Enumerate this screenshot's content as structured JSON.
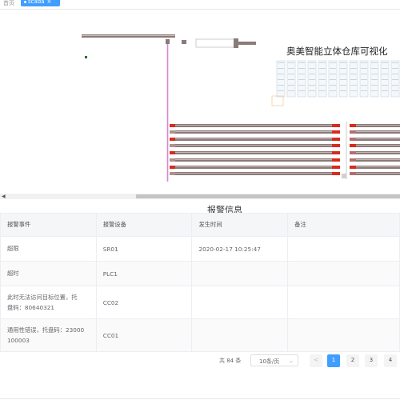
{
  "tabs": {
    "home": "首页",
    "active": "scada",
    "close": "×"
  },
  "canvas": {
    "title": "奥美智能立体仓库可视化"
  },
  "alarm": {
    "title": "报警信息",
    "columns": [
      "报警事件",
      "报警设备",
      "发生时间",
      "备注"
    ],
    "rows": [
      {
        "event": "超限",
        "device": "SR01",
        "time": "2020-02-17 10:25:47",
        "note": ""
      },
      {
        "event": "超时",
        "device": "PLC1",
        "time": "",
        "note": ""
      },
      {
        "event_line1": "此时无法访问目标位置，托",
        "event_line2": "盘码：80640321",
        "device": "CC02",
        "time": "",
        "note": ""
      },
      {
        "event_line1": "通用性错误，托盘码：23000",
        "event_line2": "100003",
        "device": "CC01",
        "time": "",
        "note": ""
      }
    ]
  },
  "pagination": {
    "total": "共 84 条",
    "page_size": "10条/页",
    "prev": "<",
    "pages": [
      "1",
      "2",
      "3",
      "4"
    ],
    "current": "1"
  },
  "colors": {
    "accent": "#409eff",
    "rack": "#8a7a78",
    "rack_red": "#d62b1f"
  }
}
